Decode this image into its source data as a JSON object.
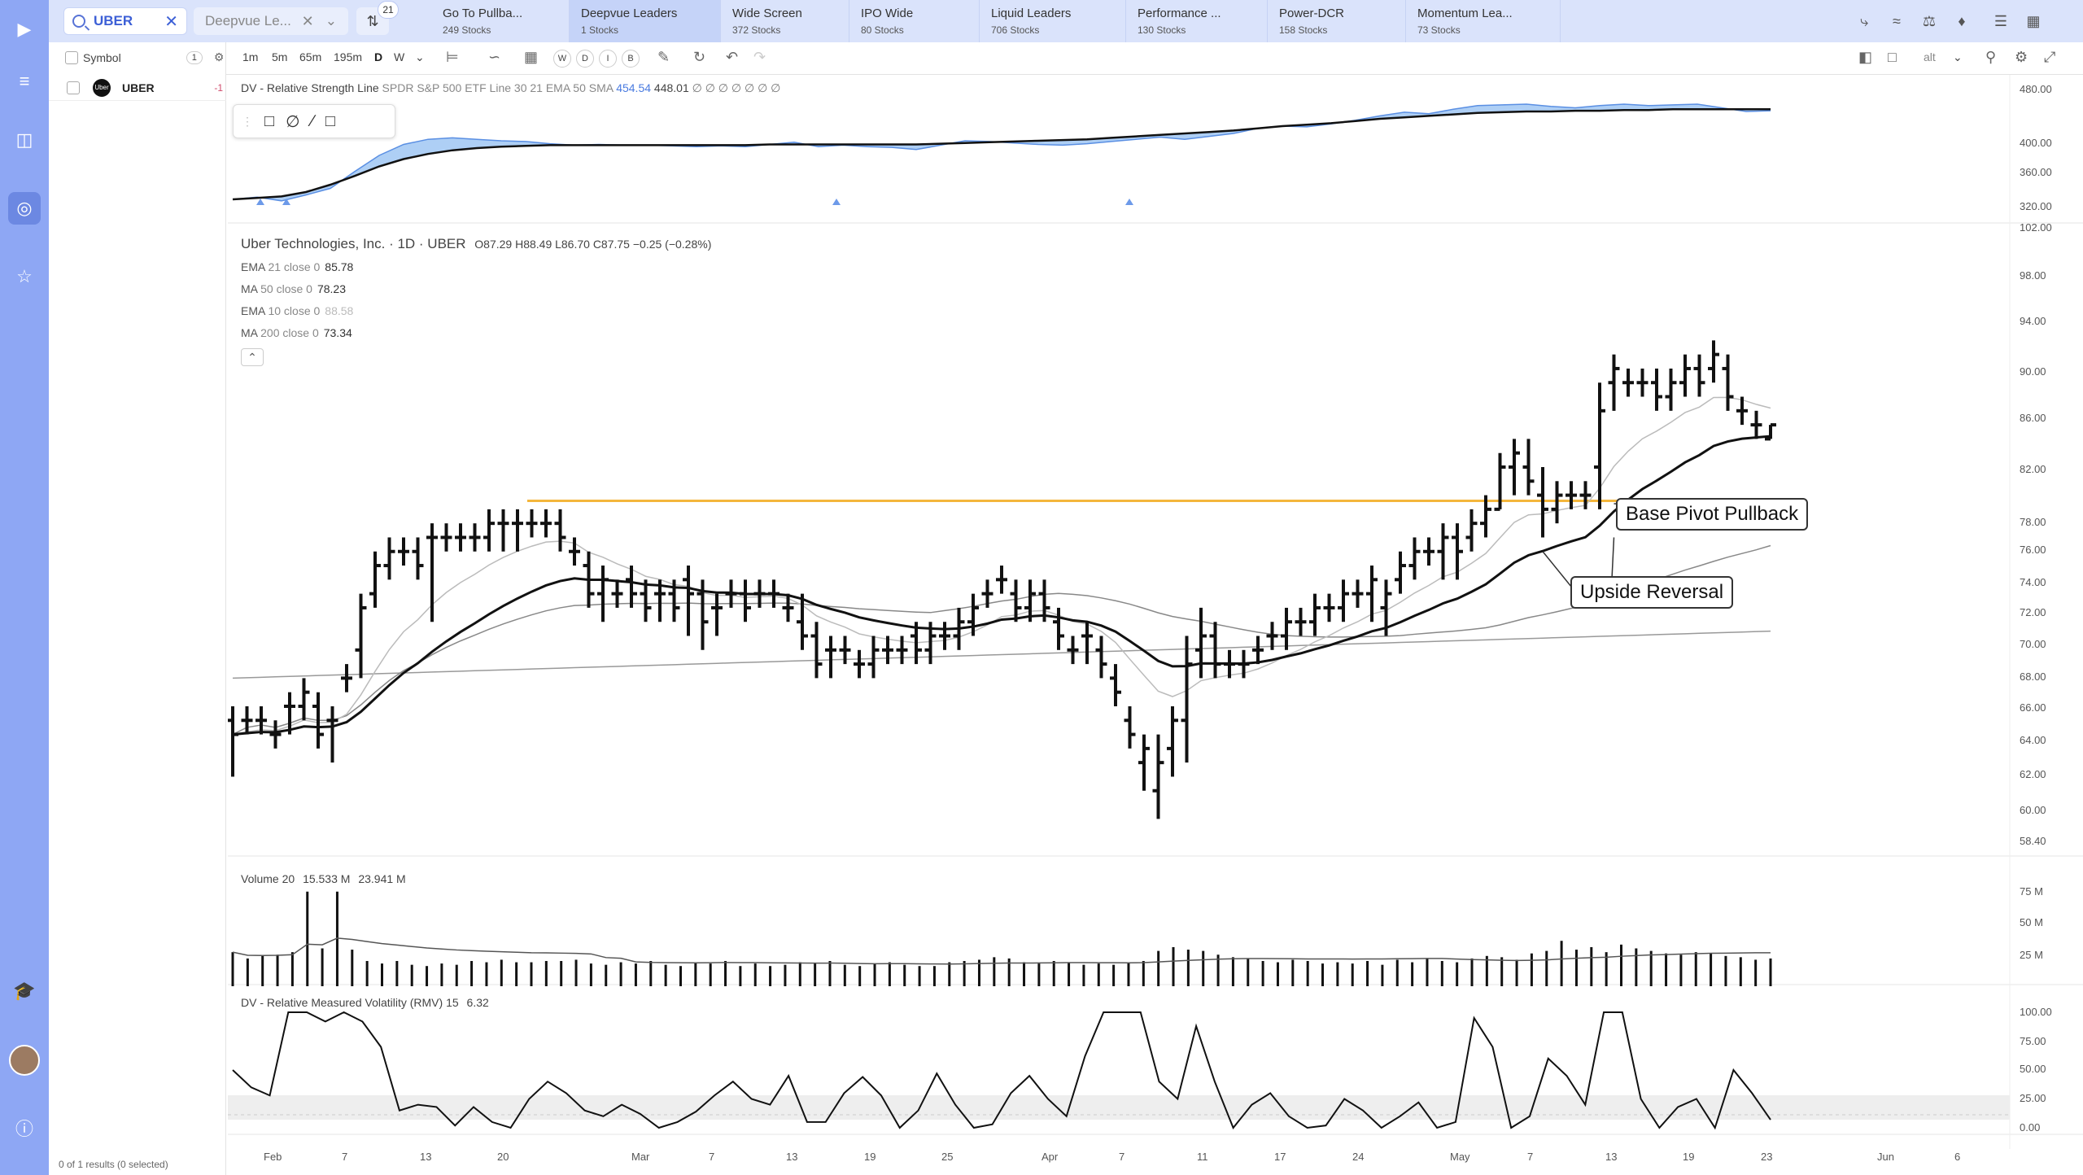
{
  "sidebar_rail": {
    "icons": [
      "play-logo-icon",
      "list-icon",
      "dashboard-icon",
      "chart-icon",
      "star-icon",
      "education-icon",
      "help-icon"
    ]
  },
  "search": {
    "value": "UBER"
  },
  "watchlist_select": {
    "label": "Deepvue Le...",
    "filter_badge": "21"
  },
  "watchlist_tabs": [
    {
      "name": "Go To Pullba...",
      "count": "249 Stocks"
    },
    {
      "name": "Deepvue Leaders",
      "count": "1 Stocks"
    },
    {
      "name": "Wide Screen",
      "count": "372 Stocks"
    },
    {
      "name": "IPO Wide",
      "count": "80 Stocks"
    },
    {
      "name": "Liquid Leaders",
      "count": "706 Stocks"
    },
    {
      "name": "Performance ...",
      "count": "130 Stocks"
    },
    {
      "name": "Power-DCR",
      "count": "158 Stocks"
    },
    {
      "name": "Momentum Lea...",
      "count": "73 Stocks"
    }
  ],
  "toolbar": {
    "intervals": [
      "1m",
      "5m",
      "65m",
      "195m",
      "D",
      "W"
    ],
    "circle_buttons": [
      "W",
      "D",
      "I",
      "B"
    ],
    "layout_label": "alt"
  },
  "symbol_list": {
    "header": "Symbol",
    "header_count": "1",
    "rows": [
      {
        "ticker": "UBER",
        "flag": "-1",
        "logo_text": "Uber"
      }
    ],
    "footer": "0 of 1 results (0 selected)"
  },
  "rs_pane": {
    "legend_name": "DV - Relative Strength Line",
    "legend_params": "SPDR S&P 500 ETF Line 30 21 EMA 50 SMA",
    "value1": "454.54",
    "value2": "448.01",
    "markers": "∅ ∅ ∅ ∅ ∅ ∅ ∅",
    "axis": [
      "480.00",
      "400.00",
      "360.00",
      "320.00"
    ]
  },
  "price_pane": {
    "title": "Uber Technologies, Inc. · 1D · UBER",
    "ohlc": "O87.29  H88.49  L86.70  C87.75  −0.25 (−0.28%)",
    "indicators": [
      {
        "name": "EMA",
        "params": "21 close 0",
        "value": "85.78"
      },
      {
        "name": "MA",
        "params": "50 close 0",
        "value": "78.23"
      },
      {
        "name": "EMA",
        "params": "10 close 0",
        "value": "88.58"
      },
      {
        "name": "MA",
        "params": "200 close 0",
        "value": "73.34"
      }
    ],
    "axis": [
      "102.00",
      "98.00",
      "94.00",
      "90.00",
      "86.00",
      "82.00",
      "78.00",
      "76.00",
      "74.00",
      "72.00",
      "70.00",
      "68.00",
      "66.00",
      "64.00",
      "62.00",
      "60.00",
      "58.40"
    ],
    "callouts": {
      "base_pivot": "Base Pivot Pullback",
      "upside_reversal": "Upside Reversal"
    },
    "pivot_line_price": 82.6,
    "colors": {
      "pivot_line": "#f4b63c",
      "bars": "#111111"
    }
  },
  "volume_pane": {
    "legend": "Volume 20",
    "value1": "15.533 M",
    "value2": "23.941 M",
    "axis": [
      "75 M",
      "50 M",
      "25 M"
    ]
  },
  "rmv_pane": {
    "legend": "DV - Relative Measured Volatility (RMV) 15",
    "value": "6.32",
    "axis": [
      "100.00",
      "75.00",
      "50.00",
      "25.00",
      "0.00"
    ]
  },
  "x_axis": [
    "Feb",
    "7",
    "13",
    "20",
    "Mar",
    "7",
    "13",
    "19",
    "25",
    "Apr",
    "7",
    "11",
    "17",
    "24",
    "May",
    "7",
    "13",
    "19",
    "23",
    "Jun",
    "6"
  ],
  "chart_data": {
    "type": "ohlc",
    "symbol": "UBER",
    "interval": "1D",
    "ylim": [
      58.4,
      102
    ],
    "bars": [
      [
        67,
        68,
        63,
        66
      ],
      [
        67,
        68,
        66,
        67
      ],
      [
        67,
        68,
        66,
        67
      ],
      [
        66,
        67,
        65,
        66
      ],
      [
        68,
        69,
        66,
        68
      ],
      [
        68,
        70,
        67,
        69
      ],
      [
        68,
        69,
        65,
        66
      ],
      [
        67,
        68,
        64,
        67
      ],
      [
        70,
        71,
        69,
        70
      ],
      [
        72,
        76,
        70,
        75
      ],
      [
        76,
        79,
        75,
        78
      ],
      [
        78,
        80,
        77,
        79
      ],
      [
        79,
        80,
        78,
        79
      ],
      [
        79,
        80,
        77,
        78
      ],
      [
        80,
        81,
        74,
        80
      ],
      [
        80,
        81,
        79,
        80
      ],
      [
        80,
        81,
        79,
        80
      ],
      [
        80,
        81,
        79,
        80
      ],
      [
        80,
        82,
        79,
        81
      ],
      [
        81,
        82,
        79,
        81
      ],
      [
        81,
        82,
        79,
        81
      ],
      [
        81,
        82,
        80,
        81
      ],
      [
        81,
        82,
        80,
        81
      ],
      [
        81,
        82,
        79,
        80
      ],
      [
        79,
        80,
        78,
        79
      ],
      [
        78,
        79,
        75,
        76
      ],
      [
        76,
        78,
        74,
        77
      ],
      [
        76,
        77,
        75,
        76
      ],
      [
        77,
        78,
        75,
        76
      ],
      [
        76,
        77,
        74,
        75
      ],
      [
        76,
        77,
        74,
        76
      ],
      [
        76,
        77,
        74,
        75
      ],
      [
        77,
        78,
        73,
        76
      ],
      [
        76,
        77,
        72,
        74
      ],
      [
        75,
        76,
        73,
        75
      ],
      [
        76,
        77,
        75,
        76
      ],
      [
        76,
        77,
        74,
        75
      ],
      [
        76,
        77,
        75,
        76
      ],
      [
        76,
        77,
        75,
        76
      ],
      [
        75,
        76,
        74,
        75
      ],
      [
        74,
        76,
        72,
        73
      ],
      [
        73,
        74,
        70,
        71
      ],
      [
        72,
        73,
        70,
        72
      ],
      [
        72,
        73,
        71,
        72
      ],
      [
        71,
        72,
        70,
        71
      ],
      [
        71,
        73,
        70,
        72
      ],
      [
        72,
        73,
        71,
        72
      ],
      [
        72,
        73,
        71,
        72
      ],
      [
        73,
        74,
        71,
        72
      ],
      [
        72,
        74,
        71,
        73
      ],
      [
        73,
        74,
        72,
        73
      ],
      [
        73,
        75,
        72,
        74
      ],
      [
        74,
        76,
        73,
        75
      ],
      [
        76,
        77,
        75,
        76
      ],
      [
        77,
        78,
        76,
        77
      ],
      [
        76,
        77,
        74,
        75
      ],
      [
        75,
        77,
        74,
        76
      ],
      [
        76,
        77,
        74,
        75
      ],
      [
        74,
        75,
        72,
        73
      ],
      [
        72,
        73,
        71,
        72
      ],
      [
        73,
        74,
        71,
        73
      ],
      [
        72,
        73,
        70,
        71
      ],
      [
        70,
        71,
        68,
        69
      ],
      [
        67,
        68,
        65,
        66
      ],
      [
        64,
        66,
        62,
        65
      ],
      [
        62,
        66,
        60,
        64
      ],
      [
        65,
        68,
        63,
        67
      ],
      [
        67,
        73,
        64,
        71
      ],
      [
        72,
        75,
        70,
        73
      ],
      [
        73,
        74,
        70,
        71
      ],
      [
        71,
        72,
        70,
        71
      ],
      [
        71,
        72,
        70,
        71
      ],
      [
        72,
        73,
        71,
        72
      ],
      [
        73,
        74,
        72,
        73
      ],
      [
        73,
        75,
        72,
        74
      ],
      [
        74,
        75,
        73,
        74
      ],
      [
        74,
        76,
        73,
        75
      ],
      [
        75,
        76,
        74,
        75
      ],
      [
        75,
        77,
        74,
        76
      ],
      [
        76,
        77,
        75,
        76
      ],
      [
        76,
        78,
        74,
        77
      ],
      [
        75,
        77,
        73,
        76
      ],
      [
        77,
        79,
        76,
        78
      ],
      [
        78,
        80,
        77,
        79
      ],
      [
        79,
        80,
        78,
        79
      ],
      [
        79,
        81,
        77,
        80
      ],
      [
        80,
        81,
        77,
        79
      ],
      [
        80,
        82,
        79,
        81
      ],
      [
        81,
        83,
        80,
        82
      ],
      [
        82,
        86,
        82,
        85
      ],
      [
        85,
        87,
        83,
        86
      ],
      [
        85,
        87,
        83,
        84
      ],
      [
        83,
        85,
        80,
        82
      ],
      [
        82,
        84,
        81,
        83
      ],
      [
        83,
        84,
        82,
        83
      ],
      [
        83,
        84,
        82,
        83
      ],
      [
        85,
        91,
        82,
        89
      ],
      [
        91,
        93,
        89,
        92
      ],
      [
        91,
        92,
        90,
        91
      ],
      [
        91,
        92,
        90,
        91
      ],
      [
        91,
        92,
        89,
        90
      ],
      [
        90,
        92,
        89,
        91
      ],
      [
        91,
        93,
        90,
        92
      ],
      [
        92,
        93,
        90,
        91
      ],
      [
        92,
        94,
        91,
        93
      ],
      [
        92,
        93,
        89,
        90
      ],
      [
        89,
        90,
        88,
        89
      ],
      [
        88,
        89,
        87,
        88
      ],
      [
        87,
        88,
        87,
        88
      ]
    ],
    "volume_m": [
      27,
      22,
      24,
      25,
      27,
      75,
      30,
      75,
      29,
      20,
      18,
      20,
      17,
      16,
      18,
      17,
      20,
      19,
      21,
      19,
      19,
      20,
      20,
      21,
      18,
      17,
      19,
      18,
      20,
      17,
      16,
      19,
      18,
      20,
      16,
      18,
      16,
      17,
      19,
      18,
      20,
      17,
      16,
      18,
      19,
      17,
      16,
      16,
      19,
      20,
      21,
      23,
      22,
      19,
      18,
      20,
      19,
      17,
      18,
      17,
      19,
      20,
      28,
      31,
      29,
      28,
      25,
      23,
      22,
      20,
      19,
      21,
      20,
      18,
      19,
      18,
      20,
      17,
      21,
      19,
      22,
      20,
      19,
      22,
      24,
      23,
      21,
      26,
      28,
      36,
      29,
      31,
      27,
      33,
      30,
      28,
      26,
      25,
      27,
      26,
      24,
      23,
      21,
      22
    ],
    "rmv": [
      50,
      35,
      28,
      100,
      100,
      92,
      100,
      92,
      70,
      15,
      20,
      18,
      2,
      18,
      5,
      0,
      25,
      40,
      30,
      15,
      10,
      20,
      12,
      0,
      5,
      14,
      28,
      40,
      25,
      20,
      45,
      5,
      5,
      30,
      44,
      28,
      0,
      15,
      47,
      20,
      0,
      3,
      30,
      45,
      25,
      10,
      62,
      100,
      100,
      100,
      40,
      25,
      88,
      40,
      0,
      20,
      30,
      10,
      0,
      2,
      25,
      15,
      0,
      10,
      22,
      0,
      5,
      95,
      70,
      0,
      10,
      60,
      45,
      20,
      100,
      100,
      25,
      0,
      18,
      25,
      0,
      50,
      30,
      7
    ],
    "rs_line": [
      330,
      333,
      328,
      336,
      345,
      368,
      390,
      405,
      412,
      414,
      412,
      410,
      409,
      406,
      404,
      405,
      404,
      404,
      403,
      402,
      403,
      402,
      405,
      408,
      402,
      404,
      402,
      401,
      398,
      404,
      410,
      409,
      407,
      405,
      404,
      406,
      409,
      412,
      415,
      412,
      416,
      420,
      427,
      430,
      429,
      433,
      438,
      444,
      449,
      447,
      453,
      458,
      459,
      460,
      457,
      455,
      458,
      460,
      458,
      459,
      460,
      455,
      450,
      451
    ],
    "ema21_rs": [
      330,
      332,
      334,
      340,
      350,
      362,
      375,
      385,
      392,
      397,
      400,
      402,
      403,
      404,
      404,
      404,
      404,
      404,
      404,
      404,
      404,
      404,
      405,
      405,
      405,
      405,
      405,
      405,
      405,
      406,
      407,
      408,
      409,
      410,
      411,
      412,
      414,
      416,
      418,
      420,
      422,
      424,
      427,
      430,
      432,
      434,
      437,
      440,
      442,
      444,
      446,
      448,
      449,
      450,
      450,
      451,
      451,
      452,
      452,
      453,
      453,
      453,
      453,
      453
    ]
  }
}
